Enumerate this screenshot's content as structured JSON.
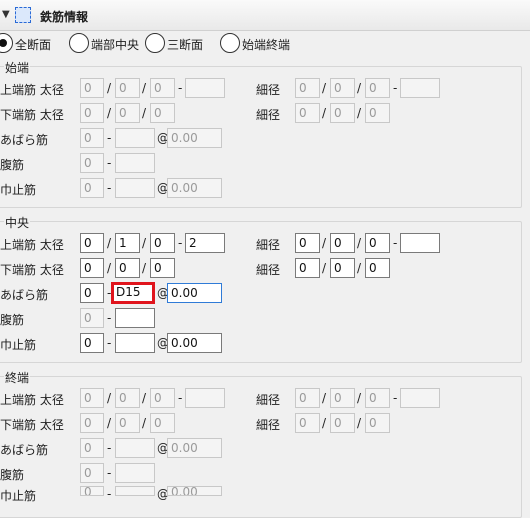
{
  "header": {
    "title": "鉄筋情報"
  },
  "section_mode": {
    "options": [
      {
        "label": "全断面",
        "selected": true
      },
      {
        "label": "端部中央",
        "selected": false
      },
      {
        "label": "三断面",
        "selected": false
      },
      {
        "label": "始端終端",
        "selected": false
      }
    ]
  },
  "labels": {
    "top_bar": "上端筋 太径",
    "bottom_bar": "下端筋 太径",
    "abara": "あばら筋",
    "web_bar": "腹筋",
    "width_stop": "巾止筋",
    "thin": "細径"
  },
  "groups": {
    "start": {
      "title": "始端",
      "top": [
        "0",
        "0",
        "0",
        ""
      ],
      "top_thin": [
        "0",
        "0",
        "0",
        ""
      ],
      "bottom": [
        "0",
        "0",
        "0"
      ],
      "bottom_thin": [
        "0",
        "0",
        "0"
      ],
      "abara": [
        "0",
        "",
        "0.00"
      ],
      "web": [
        "0",
        ""
      ],
      "stop": [
        "0",
        "",
        "0.00"
      ]
    },
    "center": {
      "title": "中央",
      "top": [
        "0",
        "1",
        "0",
        "2"
      ],
      "top_thin": [
        "0",
        "0",
        "0",
        ""
      ],
      "bottom": [
        "0",
        "0",
        "0"
      ],
      "bottom_thin": [
        "0",
        "0",
        "0"
      ],
      "abara": [
        "0",
        "D15",
        "0.00"
      ],
      "web": [
        "0",
        ""
      ],
      "stop": [
        "0",
        "",
        "0.00"
      ]
    },
    "end": {
      "title": "終端",
      "top": [
        "0",
        "0",
        "0",
        ""
      ],
      "top_thin": [
        "0",
        "0",
        "0",
        ""
      ],
      "bottom": [
        "0",
        "0",
        "0"
      ],
      "bottom_thin": [
        "0",
        "0",
        "0"
      ],
      "abara": [
        "0",
        "",
        "0.00"
      ],
      "web": [
        "0",
        ""
      ],
      "stop": [
        "0",
        "",
        "0.00"
      ]
    }
  }
}
